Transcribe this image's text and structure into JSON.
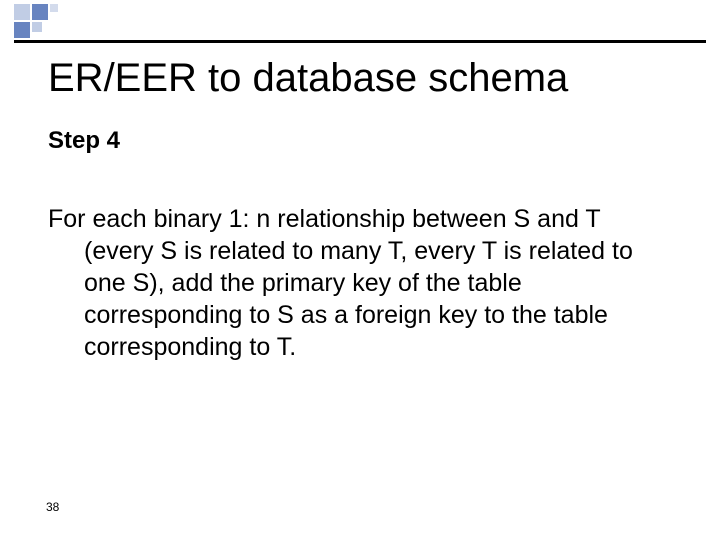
{
  "slide": {
    "title": "ER/EER to database schema",
    "step_label": "Step 4",
    "body": "For each binary 1: n relationship between S and T (every S is related to many T, every T is related to one S), add the primary key of the table corresponding to S as a foreign key to the table corresponding to T.",
    "page_number": "38"
  }
}
